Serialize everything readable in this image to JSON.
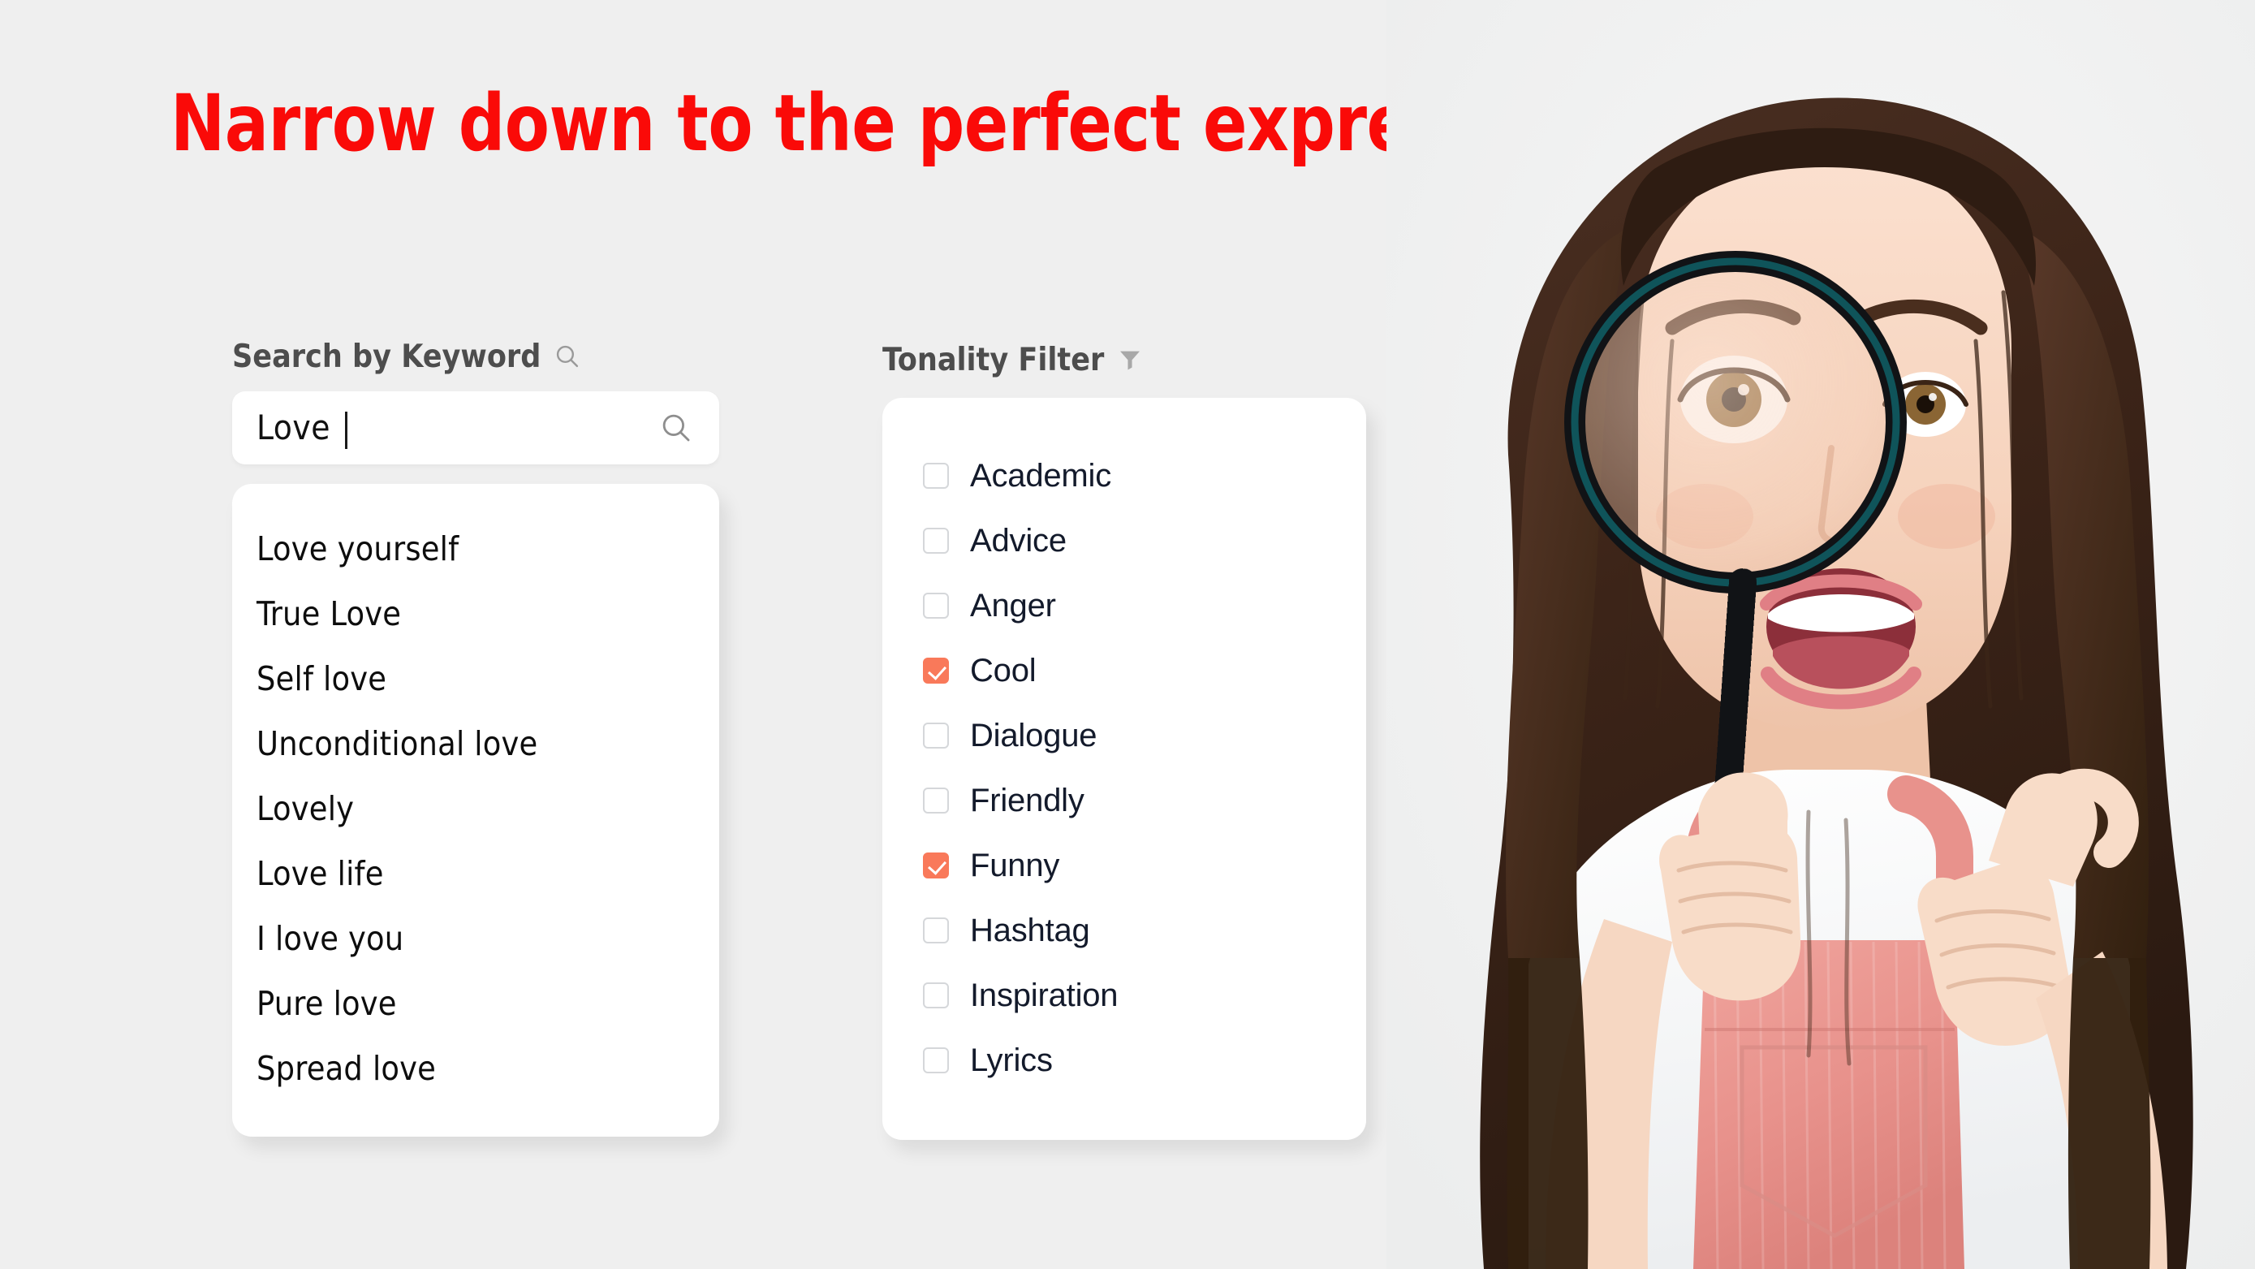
{
  "page": {
    "headline": "Narrow down to the perfect expression",
    "background_color": "#efefef",
    "headline_color": "#fa0a08"
  },
  "search_panel": {
    "title": "Search by Keyword",
    "title_icon": "search-icon",
    "input": {
      "value": "Love",
      "placeholder": "Search by keyword",
      "trailing_icon": "search-icon",
      "caret_visible": true
    },
    "suggestions": [
      "Love yourself",
      "True Love",
      "Self love",
      "Unconditional love",
      "Lovely",
      "Love life",
      "I love you",
      "Pure love",
      "Spread love"
    ]
  },
  "tonality_panel": {
    "title": "Tonality Filter",
    "title_icon": "filter-funnel-icon",
    "accent_color": "#f9795a",
    "options": [
      {
        "label": "Academic",
        "checked": false
      },
      {
        "label": "Advice",
        "checked": false
      },
      {
        "label": "Anger",
        "checked": false
      },
      {
        "label": "Cool",
        "checked": true
      },
      {
        "label": "Dialogue",
        "checked": false
      },
      {
        "label": "Friendly",
        "checked": false
      },
      {
        "label": "Funny",
        "checked": true
      },
      {
        "label": "Hashtag",
        "checked": false
      },
      {
        "label": "Inspiration",
        "checked": false
      },
      {
        "label": "Lyrics",
        "checked": false
      }
    ]
  },
  "photo": {
    "alt": "Excited woman looking through a magnifying glass",
    "icon": "magnifying-glass-woman-photo"
  }
}
